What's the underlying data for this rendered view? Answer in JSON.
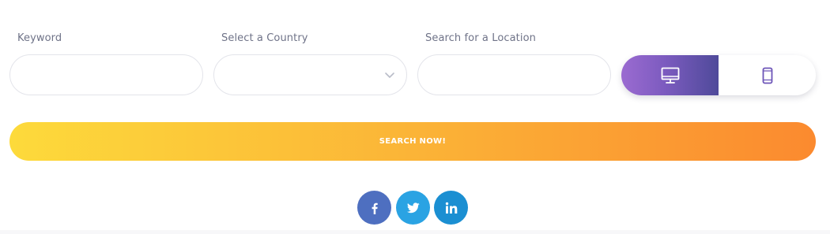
{
  "form": {
    "keyword": {
      "label": "Keyword",
      "value": ""
    },
    "country": {
      "label": "Select a Country",
      "value": ""
    },
    "location": {
      "label": "Search for a Location",
      "value": ""
    }
  },
  "device_toggle": {
    "options": [
      {
        "icon": "desktop-icon",
        "active": true
      },
      {
        "icon": "mobile-icon",
        "active": false
      }
    ]
  },
  "search_button": {
    "label": "SEARCH NOW!"
  },
  "social": [
    {
      "icon": "facebook-icon",
      "color": "#4e6fc0"
    },
    {
      "icon": "twitter-icon",
      "color": "#2aa3e3"
    },
    {
      "icon": "linkedin-icon",
      "color": "#1b8fd2"
    }
  ],
  "colors": {
    "accent_purple": "#7c5bbf",
    "accent_orange": "#fb8a2f",
    "accent_yellow": "#fdda3b",
    "label_text": "#6f7388"
  }
}
